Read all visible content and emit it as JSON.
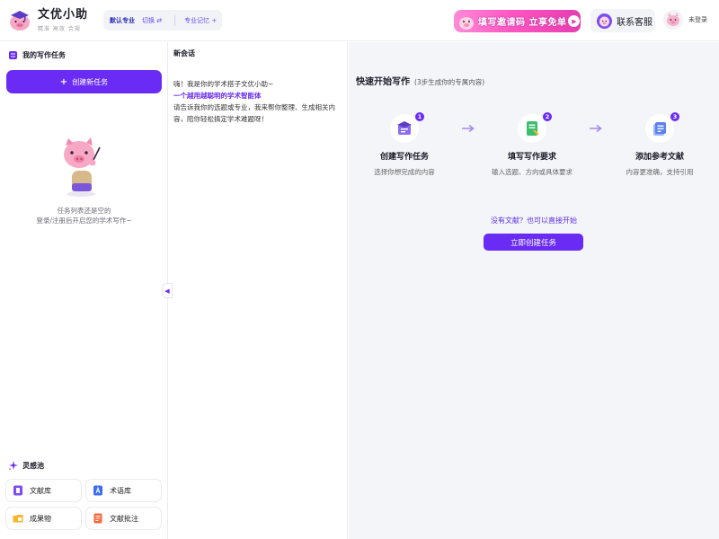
{
  "header": {
    "brand_name": "文优小助",
    "brand_slogan": "精准 高效 合规",
    "mode_label": "默认专业",
    "switch_label": "切换 ⇄",
    "memory_label": "专业记忆 +",
    "banner_text": "填写邀请码 立享免单",
    "service_label": "联系客服",
    "login_label": "未登录"
  },
  "sidebar": {
    "title": "我的写作任务",
    "create_button": "创建新任务",
    "empty_line1": "任务列表还是空的",
    "empty_line2": "登录/注册后开启您的学术写作~",
    "inspire_title": "灵感池",
    "tools": [
      {
        "label": "文献库",
        "icon": "book-icon"
      },
      {
        "label": "术语库",
        "icon": "term-icon"
      },
      {
        "label": "成果物",
        "icon": "folder-icon"
      },
      {
        "label": "文献批注",
        "icon": "annotation-icon"
      }
    ]
  },
  "conversation": {
    "title": "新会话",
    "greeting": "嗨！我是你的学术搭子文优小助~",
    "tagline": "一个越用越聪明的学术智能体",
    "intro": "请告诉我你的选题或专业，我来帮你整理、生成相关内容，陪你轻松搞定学术难题呀！"
  },
  "main": {
    "title": "快速开始写作",
    "subtitle": "(3步生成你的专属内容)",
    "steps": [
      {
        "num": "1",
        "title": "创建写作任务",
        "desc": "选择你想完成的内容"
      },
      {
        "num": "2",
        "title": "填写写作要求",
        "desc": "输入选题、方向或具体要求"
      },
      {
        "num": "3",
        "title": "添加参考文献",
        "desc": "内容更准确，支持引用"
      }
    ],
    "no_ref_text": "没有文献？也可以直接开始",
    "start_button": "立即创建任务"
  },
  "colors": {
    "accent": "#6a2cf5",
    "banner_pink": "#ff56c1",
    "main_bg": "#f4f5f9"
  }
}
